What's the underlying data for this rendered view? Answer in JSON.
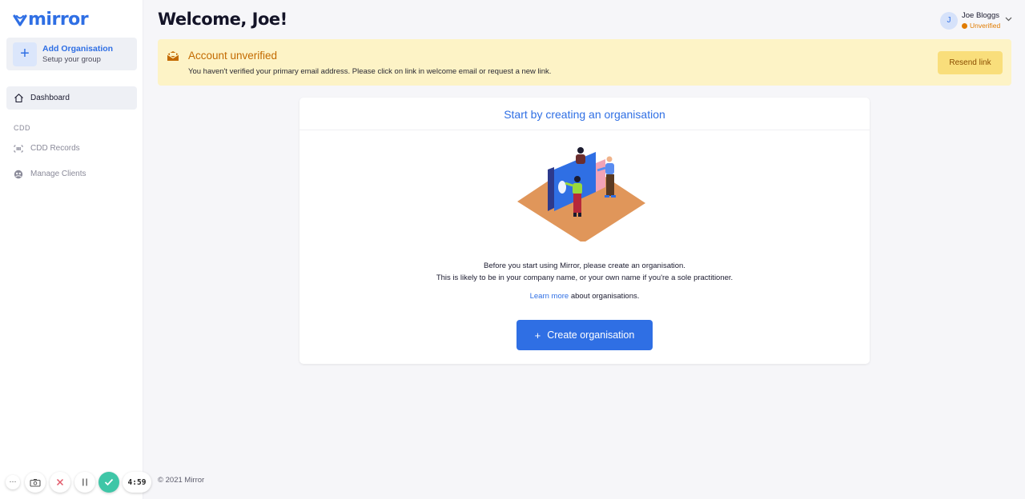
{
  "brand": {
    "name": "mirror",
    "color": "#2f6fe4"
  },
  "sidebar": {
    "add_org": {
      "title": "Add Organisation",
      "subtitle": "Setup your group",
      "icon": "plus-icon"
    },
    "items": [
      {
        "label": "Dashboard",
        "icon": "home-icon",
        "active": true
      }
    ],
    "section_label": "CDD",
    "section_items": [
      {
        "label": "CDD Records",
        "icon": "barcode-scan-icon"
      },
      {
        "label": "Manage Clients",
        "icon": "users-icon"
      }
    ]
  },
  "header": {
    "title": "Welcome, Joe!",
    "user": {
      "initial": "J",
      "name": "Joe Bloggs",
      "status": "Unverified"
    }
  },
  "banner": {
    "icon": "envelope-open-icon",
    "title": "Account unverified",
    "message": "You haven't verified your primary email address. Please click on link in welcome email or request a new link.",
    "action_label": "Resend link"
  },
  "card": {
    "title": "Start by creating an organisation",
    "line1": "Before you start using Mirror, please create an organisation.",
    "line2": "This is likely to be in your company name, or your own name if you're a sole practitioner.",
    "learn_link": "Learn more",
    "learn_suffix": " about organisations.",
    "button_plus": "+",
    "button_label": "Create organisation"
  },
  "footer": {
    "text": "© 2021 Mirror"
  },
  "recorder": {
    "timer": "4:59",
    "more": "···"
  }
}
